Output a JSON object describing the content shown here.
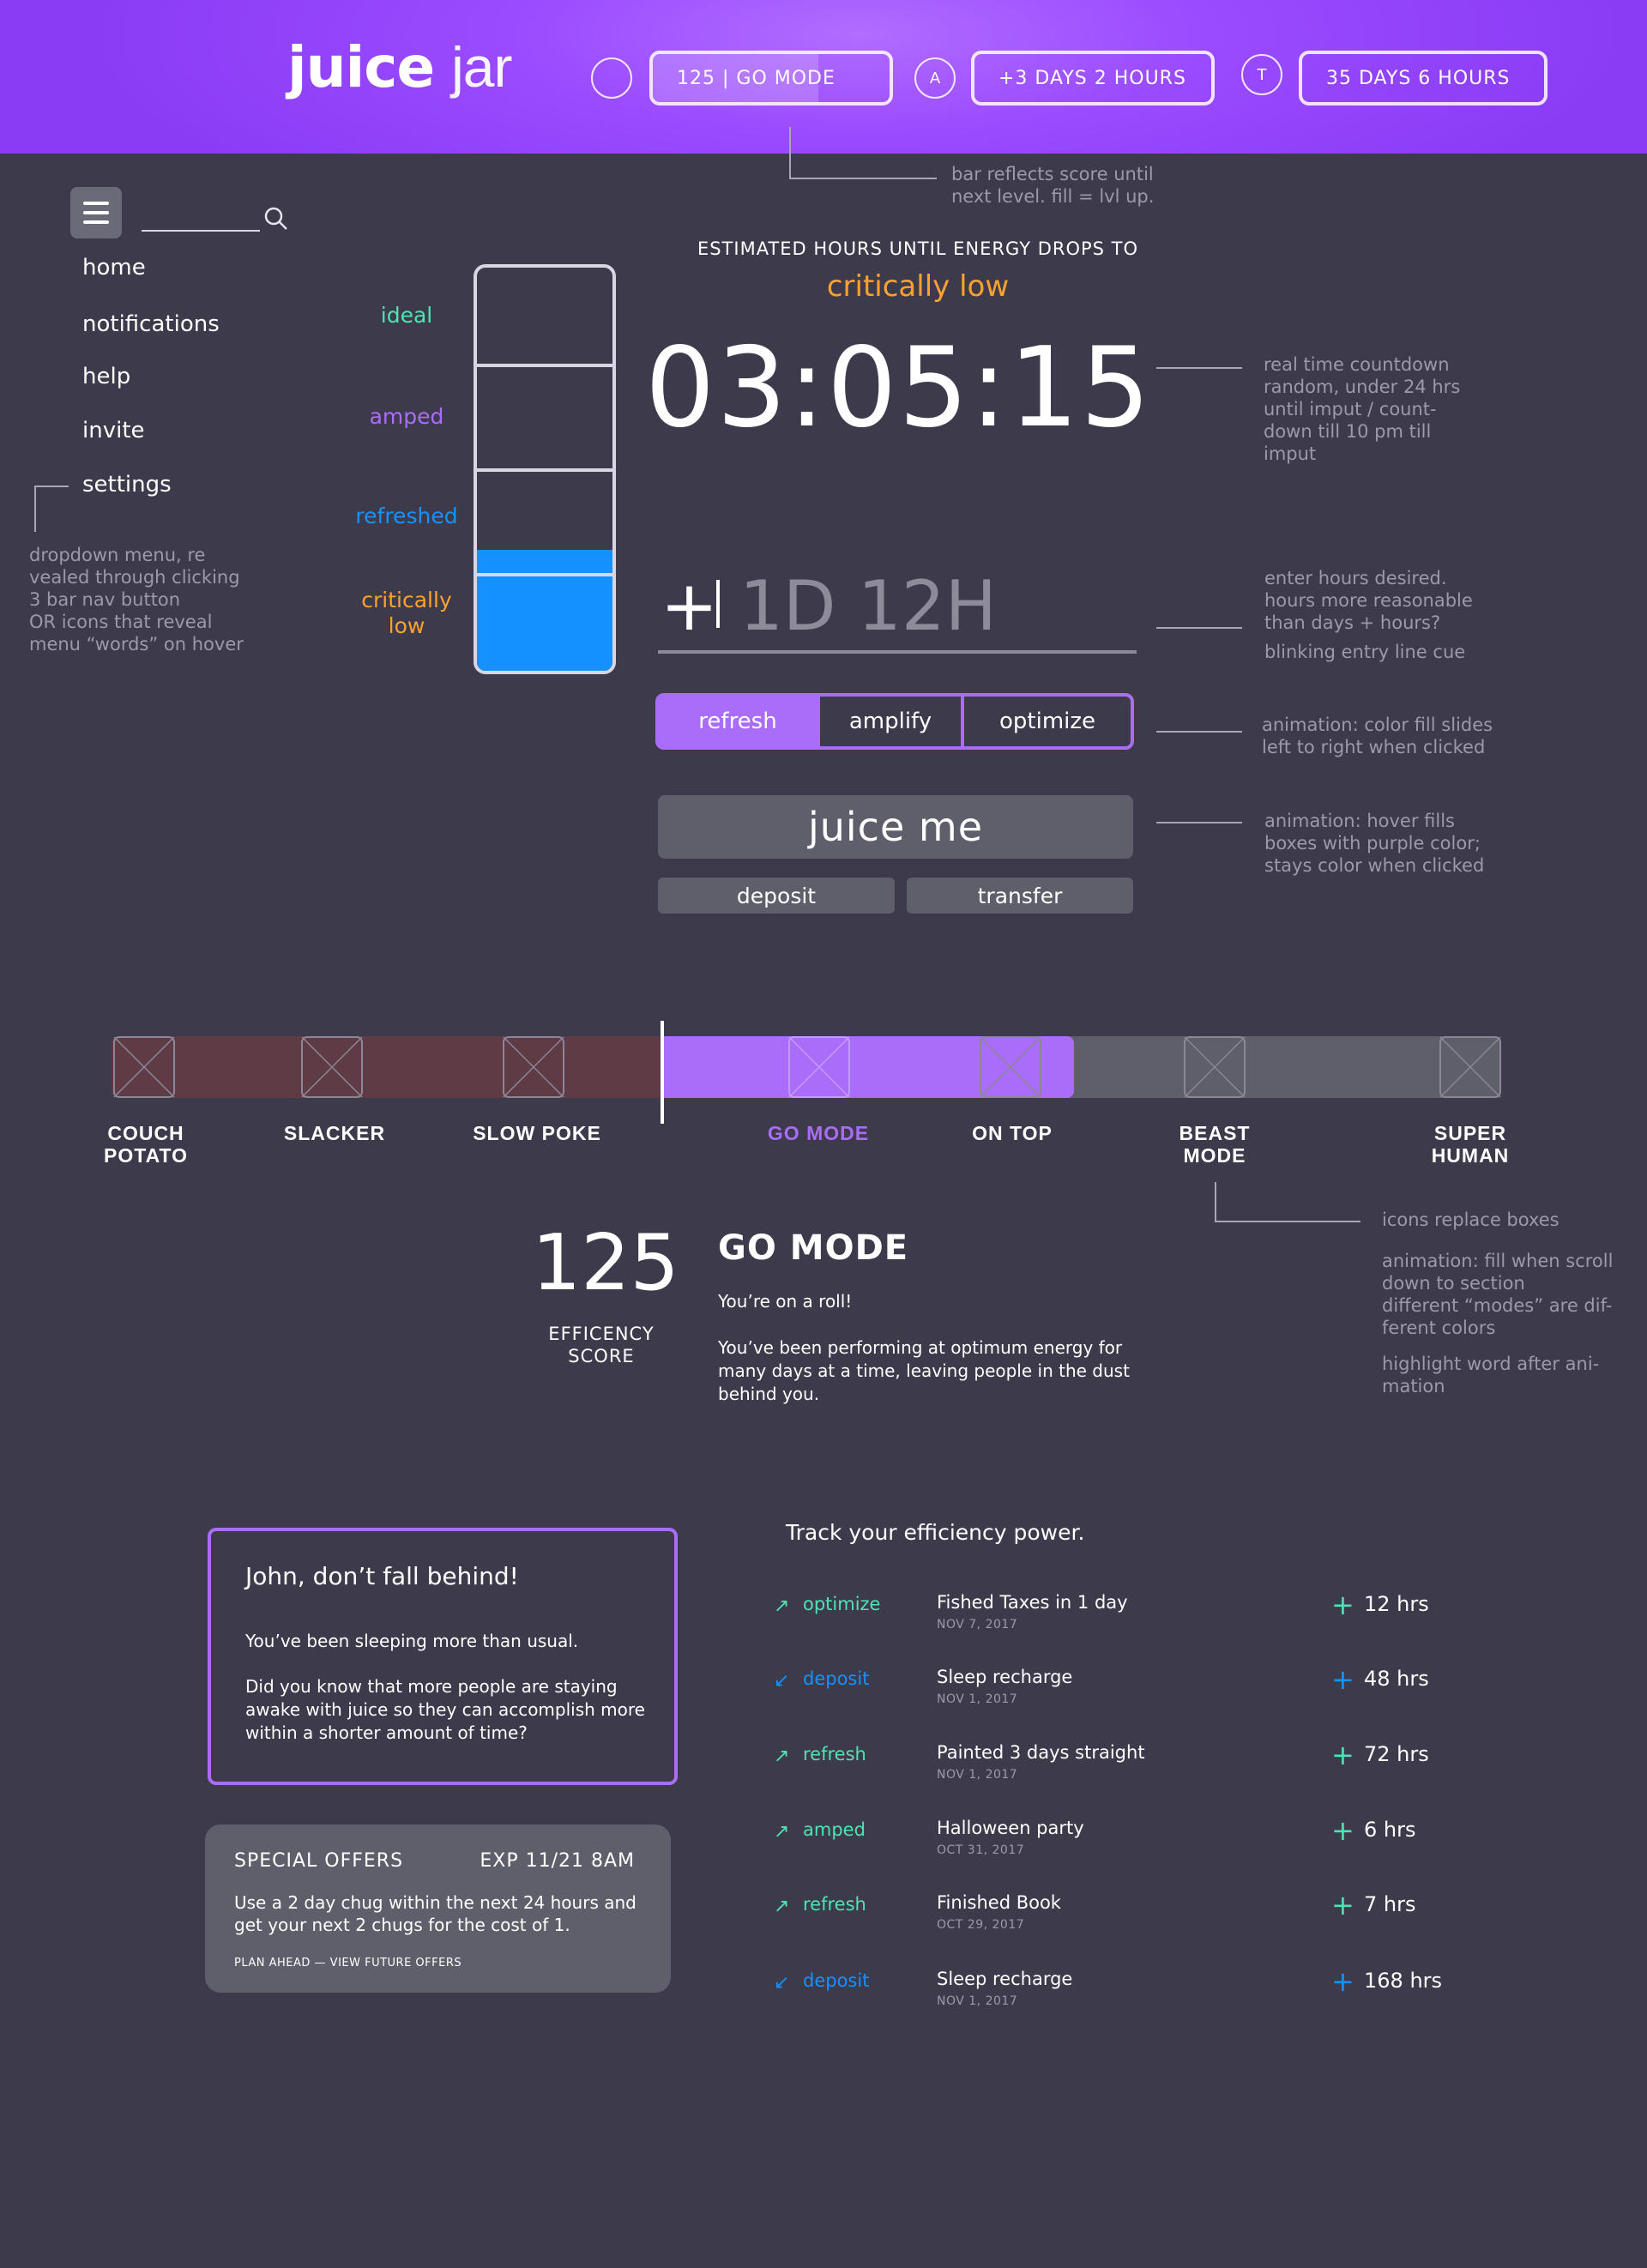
{
  "colors": {
    "header_purple": "#9a4bff",
    "accent_purple": "#a96df9",
    "background": "#3d3b4b",
    "ideal": "#4fe3b4",
    "amped": "#a96df9",
    "refreshed": "#1592ff",
    "critical": "#ffa12e",
    "past_levels": "#5e3b45",
    "button_gray": "#5f5e6b",
    "note_gray": "#9c9aa8"
  },
  "header": {
    "logo_bold": "juice",
    "logo_thin": "jar",
    "icon1": "",
    "score_pill": "125 | GO MODE",
    "score_progress": 0.7,
    "icon2": "A",
    "pill2": "+3 DAYS 2 HOURS",
    "icon3": "T",
    "pill3": "35 DAYS 6 HOURS"
  },
  "notes": {
    "score_bar": [
      "bar reflects score until",
      "next level. fill = lvl up."
    ],
    "countdown": [
      "real time countdown",
      "random, under 24 hrs",
      "until imput / count-",
      "down till 10 pm till",
      "imput"
    ],
    "entry": [
      "enter hours desired.",
      "hours more reasonable",
      "than days + hours?"
    ],
    "entry_cue": "blinking entry line cue",
    "modes": [
      "animation: color fill slides",
      "left to right when clicked"
    ],
    "juice": [
      "animation: hover fills",
      "boxes with purple color;",
      "stays color when clicked"
    ],
    "menu": [
      "dropdown menu, re",
      "vealed through clicking",
      "3 bar nav button",
      "OR icons that reveal",
      "menu “words” on hover"
    ],
    "icons": "icons replace boxes",
    "levels_anim": [
      "animation: fill when scroll",
      "down to section",
      "different “modes” are dif-",
      "ferent colors"
    ],
    "highlight": [
      "highlight word after ani-",
      "mation"
    ]
  },
  "sidebar": {
    "search_placeholder": "",
    "items": [
      {
        "label": "home"
      },
      {
        "label": "notifications"
      },
      {
        "label": "help"
      },
      {
        "label": "invite"
      },
      {
        "label": "settings"
      }
    ]
  },
  "gauge": {
    "levels": [
      {
        "label": "ideal",
        "color": "#4fe3b4"
      },
      {
        "label": "amped",
        "color": "#a96df9"
      },
      {
        "label": "refreshed",
        "color": "#1592ff"
      },
      {
        "label": "critically low",
        "color": "#ffa12e"
      }
    ],
    "fill_fraction": 0.3
  },
  "countdown": {
    "label": "ESTIMATED HOURS UNTIL ENERGY DROPS TO",
    "target": "critically low",
    "time": "03:05:15"
  },
  "entry": {
    "prefix": "+",
    "value": "1D 12H"
  },
  "modes": {
    "items": [
      {
        "label": "refresh",
        "active": true
      },
      {
        "label": "amplify",
        "active": false
      },
      {
        "label": "optimize",
        "active": false
      }
    ]
  },
  "actions": {
    "juice": "juice me",
    "deposit": "deposit",
    "transfer": "transfer"
  },
  "levels": {
    "names": [
      "COUCH POTATO",
      "SLACKER",
      "SLOW POKE",
      "GO MODE",
      "ON TOP",
      "BEAST MODE",
      "SUPER HUMAN"
    ],
    "current_index": 3
  },
  "score": {
    "value": "125",
    "label": "EFFICENCY SCORE",
    "mode_title": "GO MODE",
    "mode_sub": "You’re on a roll!",
    "mode_desc": "You’ve been performing at optimum energy for many days at a time, leaving people in the dust behind you."
  },
  "alert": {
    "title": "John, don’t fall behind!",
    "p1": "You’ve been sleeping more than usual.",
    "p2": "Did you know that more people are staying awake with juice so they can accomplish more within a shorter amount of time?"
  },
  "offer": {
    "title": "SPECIAL OFFERS",
    "exp": "EXP 11/21 8AM",
    "body": "Use a 2 day chug within the next 24 hours and get your next 2 chugs for the cost of 1.",
    "link": "PLAN AHEAD — VIEW FUTURE OFFERS"
  },
  "tracker": {
    "title": "Track your efficiency power.",
    "rows": [
      {
        "icon": "↗",
        "tag": "optimize",
        "tag_color": "#4fe3b4",
        "desc": "Fished Taxes in 1 day",
        "date": "NOV 7, 2017",
        "hrs": "12 hrs"
      },
      {
        "icon": "↙",
        "tag": "deposit",
        "tag_color": "#1592ff",
        "desc": "Sleep recharge",
        "date": "NOV 1, 2017",
        "hrs": "48 hrs"
      },
      {
        "icon": "↗",
        "tag": "refresh",
        "tag_color": "#4fe3b4",
        "desc": "Painted 3 days straight",
        "date": "NOV 1, 2017",
        "hrs": "72 hrs"
      },
      {
        "icon": "↗",
        "tag": "amped",
        "tag_color": "#4fe3b4",
        "desc": "Halloween party",
        "date": "OCT 31, 2017",
        "hrs": "6 hrs"
      },
      {
        "icon": "↗",
        "tag": "refresh",
        "tag_color": "#4fe3b4",
        "desc": "Finished Book",
        "date": "OCT 29, 2017",
        "hrs": "7 hrs"
      },
      {
        "icon": "↙",
        "tag": "deposit",
        "tag_color": "#1592ff",
        "desc": "Sleep recharge",
        "date": "NOV 1, 2017",
        "hrs": "168 hrs"
      }
    ]
  }
}
